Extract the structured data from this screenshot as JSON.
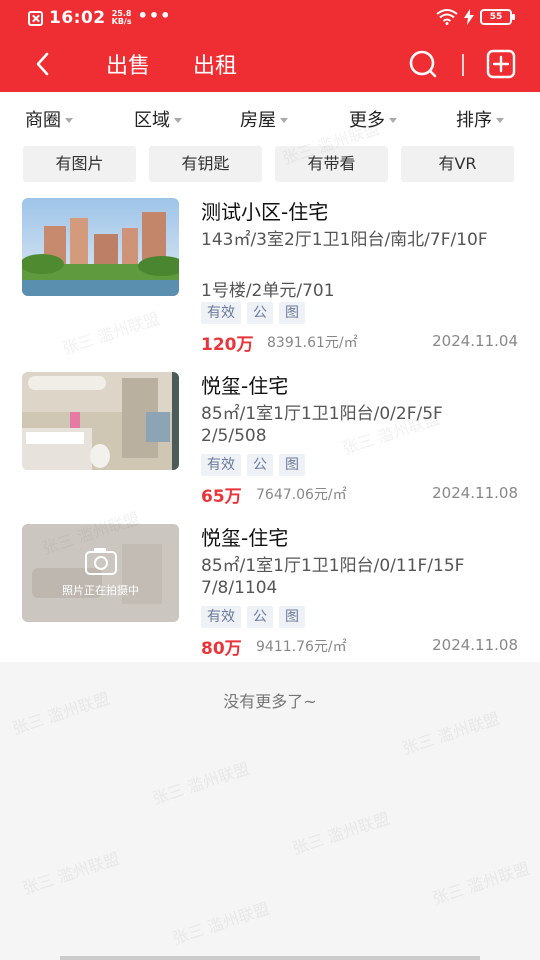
{
  "status_bar": {
    "time": "16:02",
    "speed_value": "25.8",
    "speed_unit": "KB/s",
    "dots": "•••",
    "battery": "55"
  },
  "nav": {
    "tabs": [
      {
        "label": "出售"
      },
      {
        "label": "出租"
      }
    ]
  },
  "filters": [
    {
      "label": "商圈"
    },
    {
      "label": "区域"
    },
    {
      "label": "房屋"
    },
    {
      "label": "更多"
    },
    {
      "label": "排序"
    }
  ],
  "chips": [
    {
      "label": "有图片"
    },
    {
      "label": "有钥匙"
    },
    {
      "label": "有带看"
    },
    {
      "label": "有VR"
    }
  ],
  "listings": [
    {
      "title": "测试小区-住宅",
      "desc": "143㎡/3室2厅1卫1阳台/南北/7F/10F",
      "address": "1号楼/2单元/701",
      "tags": [
        "有效",
        "公",
        "图"
      ],
      "price": "120万",
      "unit_price": "8391.61元/㎡",
      "date": "2024.11.04",
      "photo": "building"
    },
    {
      "title": "悦玺-住宅",
      "desc": "85㎡/1室1厅1卫1阳台/0/2F/5F",
      "address": "2/5/508",
      "tags": [
        "有效",
        "公",
        "图"
      ],
      "price": "65万",
      "unit_price": "7647.06元/㎡",
      "date": "2024.11.08",
      "photo": "bathroom"
    },
    {
      "title": "悦玺-住宅",
      "desc": "85㎡/1室1厅1卫1阳台/0/11F/15F",
      "address": "7/8/1104",
      "tags": [
        "有效",
        "公",
        "图"
      ],
      "price": "80万",
      "unit_price": "9411.76元/㎡",
      "date": "2024.11.08",
      "photo": "placeholder",
      "photo_caption": "照片正在拍摄中"
    }
  ],
  "footer": {
    "no_more": "没有更多了~"
  },
  "watermark_text": "张三 滥州联盟",
  "colors": {
    "brand_red": "#ee2e32",
    "price_red": "#e8343a",
    "tag_bg": "#eef1f6"
  }
}
